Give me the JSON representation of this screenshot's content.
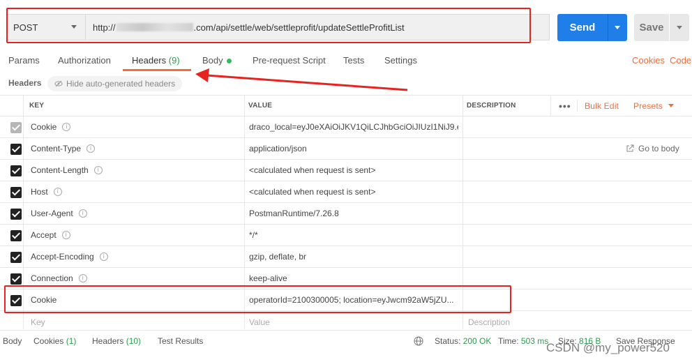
{
  "request": {
    "method": "POST",
    "url_prefix": "http://",
    "url_suffix": ".com/api/settle/web/settleprofit/updateSettleProfitList",
    "send_label": "Send",
    "save_label": "Save"
  },
  "tabs": [
    {
      "label": "Params"
    },
    {
      "label": "Authorization"
    },
    {
      "label": "Headers",
      "count": "(9)"
    },
    {
      "label": "Body"
    },
    {
      "label": "Pre-request Script"
    },
    {
      "label": "Tests"
    },
    {
      "label": "Settings"
    }
  ],
  "right_links": {
    "cookies": "Cookies",
    "code": "Code"
  },
  "headers_section": {
    "title": "Headers",
    "hide_label": "Hide auto-generated headers"
  },
  "table": {
    "columns": {
      "key": "KEY",
      "value": "VALUE",
      "description": "DESCRIPTION"
    },
    "bulk_edit": "Bulk Edit",
    "presets": "Presets",
    "goto_body": "Go to body",
    "rows": [
      {
        "key": "Cookie",
        "value": "draco_local=eyJ0eXAiOiJKV1QiLCJhbGciOiJIUzI1NiJ9.e...",
        "checked": "gray"
      },
      {
        "key": "Content-Type",
        "value": "application/json",
        "checked": "true"
      },
      {
        "key": "Content-Length",
        "value": "<calculated when request is sent>",
        "checked": "true"
      },
      {
        "key": "Host",
        "value": "<calculated when request is sent>",
        "checked": "true"
      },
      {
        "key": "User-Agent",
        "value": "PostmanRuntime/7.26.8",
        "checked": "true"
      },
      {
        "key": "Accept",
        "value": "*/*",
        "checked": "true"
      },
      {
        "key": "Accept-Encoding",
        "value": "gzip, deflate, br",
        "checked": "true"
      },
      {
        "key": "Connection",
        "value": "keep-alive",
        "checked": "true"
      },
      {
        "key": "Cookie",
        "value": "operatorId=2100300005; location=eyJwcm92aW5jZU...",
        "checked": "true"
      }
    ],
    "placeholders": {
      "key": "Key",
      "value": "Value",
      "description": "Description"
    }
  },
  "response_bar": {
    "body": "Body",
    "cookies": "Cookies",
    "cookies_count": "(1)",
    "headers": "Headers",
    "headers_count": "(10)",
    "test_results": "Test Results",
    "status_label": "Status:",
    "status_value": "200 OK",
    "time_label": "Time:",
    "time_value": "503 ms",
    "size_label": "Size:",
    "size_value": "816 B",
    "save_response": "Save Response"
  },
  "watermark": "CSDN @my_power520",
  "colors": {
    "accent": "#f26b3a",
    "send": "#1f7ee8",
    "annotation": "#e8231f",
    "success": "#2a9d4a"
  }
}
